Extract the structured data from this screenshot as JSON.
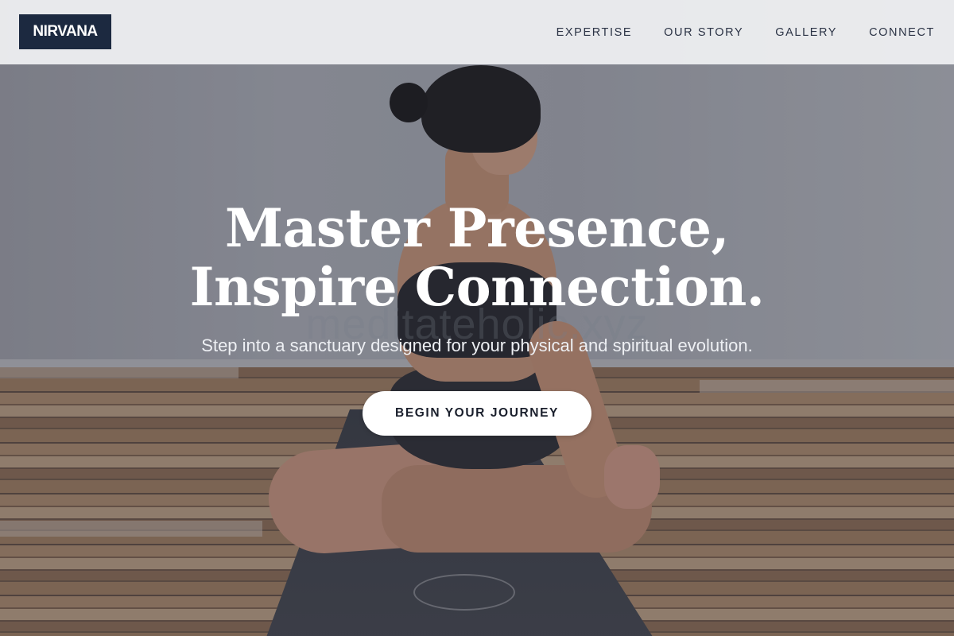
{
  "header": {
    "logo_text": "NIRVANA",
    "nav": [
      {
        "label": "EXPERTISE"
      },
      {
        "label": "OUR STORY"
      },
      {
        "label": "GALLERY"
      },
      {
        "label": "CONNECT"
      }
    ]
  },
  "hero": {
    "title": "Master Presence, Inspire Connection.",
    "watermark": "meditateholic.xyz",
    "subtitle": "Step into a sanctuary designed for your physical and spiritual evolution.",
    "cta_label": "BEGIN YOUR JOURNEY"
  },
  "colors": {
    "logo_bg": "#1c2940",
    "header_bg": "#f0f1f3",
    "nav_text": "#2c3446",
    "cta_bg": "#ffffff",
    "cta_text": "#1a1f2c"
  }
}
